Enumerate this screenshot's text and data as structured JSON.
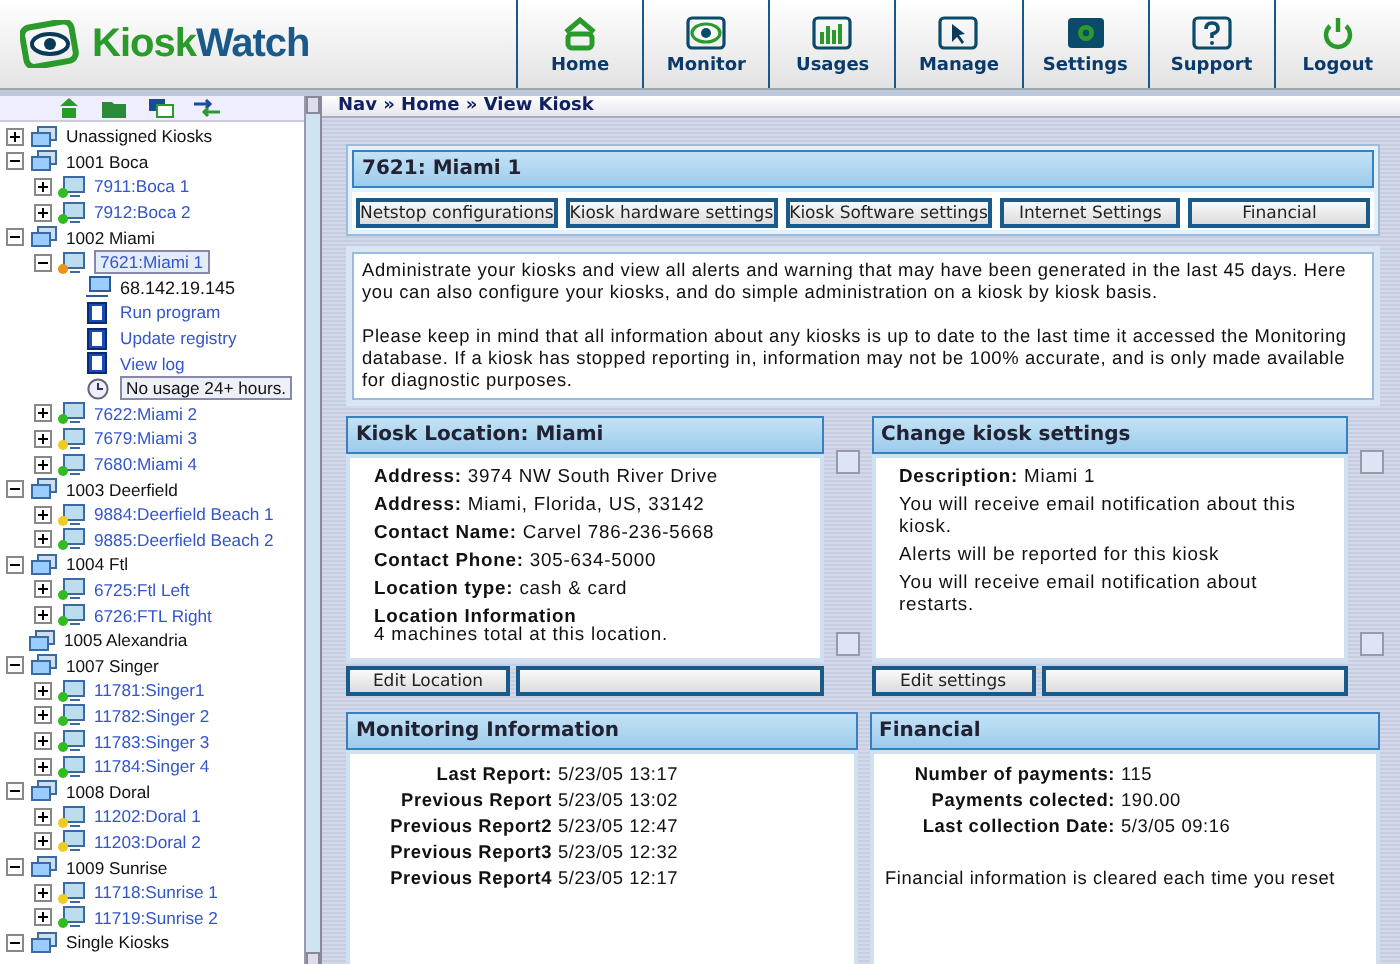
{
  "logo": {
    "first": "Kiosk",
    "second": "Watch"
  },
  "nav": [
    {
      "label": "Home"
    },
    {
      "label": "Monitor"
    },
    {
      "label": "Usages"
    },
    {
      "label": "Manage"
    },
    {
      "label": "Settings"
    },
    {
      "label": "Support"
    },
    {
      "label": "Logout"
    }
  ],
  "tree": [
    {
      "kind": "group",
      "label": "Unassigned Kiosks",
      "expanded": false
    },
    {
      "kind": "group",
      "label": "1001 Boca",
      "expanded": true,
      "children": [
        {
          "kind": "kiosk",
          "label": "7911:Boca 1",
          "expanded": false,
          "color": "#33bb22",
          "selected": false
        },
        {
          "kind": "kiosk",
          "label": "7912:Boca 2",
          "expanded": false,
          "color": "#33bb22",
          "selected": false
        }
      ]
    },
    {
      "kind": "group",
      "label": "1002 Miami",
      "expanded": true,
      "children": [
        {
          "kind": "kiosk",
          "label": "7621:Miami 1",
          "expanded": true,
          "color": "#e8941a",
          "selected": true,
          "children": [
            {
              "kind": "ip",
              "label": "68.142.19.145"
            },
            {
              "kind": "action",
              "label": "Run program"
            },
            {
              "kind": "action",
              "label": "Update registry"
            },
            {
              "kind": "action",
              "label": "View log"
            },
            {
              "kind": "alert",
              "label": "No usage 24+ hours."
            }
          ]
        },
        {
          "kind": "kiosk",
          "label": "7622:Miami 2",
          "expanded": false,
          "color": "#33bb22",
          "selected": false
        },
        {
          "kind": "kiosk",
          "label": "7679:Miami 3",
          "expanded": false,
          "color": "#eecc22",
          "selected": false
        },
        {
          "kind": "kiosk",
          "label": "7680:Miami 4",
          "expanded": false,
          "color": "#33bb22",
          "selected": false
        }
      ]
    },
    {
      "kind": "group",
      "label": "1003 Deerfield",
      "expanded": true,
      "children": [
        {
          "kind": "kiosk",
          "label": "9884:Deerfield Beach 1",
          "expanded": false,
          "color": "#eecc22",
          "selected": false
        },
        {
          "kind": "kiosk",
          "label": "9885:Deerfield Beach 2",
          "expanded": false,
          "color": "#33bb22",
          "selected": false
        }
      ]
    },
    {
      "kind": "group",
      "label": "1004 Ftl",
      "expanded": true,
      "children": [
        {
          "kind": "kiosk",
          "label": "6725:Ftl Left",
          "expanded": false,
          "color": "#33bb22",
          "selected": false
        },
        {
          "kind": "kiosk",
          "label": "6726:FTL Right",
          "expanded": false,
          "color": "#33bb22",
          "selected": false
        }
      ]
    },
    {
      "kind": "group",
      "label": "1005 Alexandria"
    },
    {
      "kind": "group",
      "label": "1007 Singer",
      "expanded": true,
      "children": [
        {
          "kind": "kiosk",
          "label": "11781:Singer1",
          "expanded": false,
          "color": "#33bb22",
          "selected": false
        },
        {
          "kind": "kiosk",
          "label": "11782:Singer 2",
          "expanded": false,
          "color": "#33bb22",
          "selected": false
        },
        {
          "kind": "kiosk",
          "label": "11783:Singer 3",
          "expanded": false,
          "color": "#33bb22",
          "selected": false
        },
        {
          "kind": "kiosk",
          "label": "11784:Singer 4",
          "expanded": false,
          "color": "#33bb22",
          "selected": false
        }
      ]
    },
    {
      "kind": "group",
      "label": "1008 Doral",
      "expanded": true,
      "children": [
        {
          "kind": "kiosk",
          "label": "11202:Doral 1",
          "expanded": false,
          "color": "#eecc22",
          "selected": false
        },
        {
          "kind": "kiosk",
          "label": "11203:Doral 2",
          "expanded": false,
          "color": "#eecc22",
          "selected": false
        }
      ]
    },
    {
      "kind": "group",
      "label": "1009 Sunrise",
      "expanded": true,
      "children": [
        {
          "kind": "kiosk",
          "label": "11718:Sunrise 1",
          "expanded": false,
          "color": "#eecc22",
          "selected": false
        },
        {
          "kind": "kiosk",
          "label": "11719:Sunrise 2",
          "expanded": false,
          "color": "#33bb22",
          "selected": false
        }
      ]
    },
    {
      "kind": "group",
      "label": "Single Kiosks",
      "expanded": true
    }
  ],
  "breadcrumb": "Nav » Home » View Kiosk",
  "kiosk_panel": {
    "title": "7621: Miami 1",
    "buttons": [
      "Netstop configurations",
      "Kiosk hardware settings",
      "Kiosk Software settings",
      "Internet Settings",
      "Financial"
    ]
  },
  "intro": [
    "Administrate your kiosks and view all alerts and warning that may have been generated in the last 45 days. Here you can also configure your kiosks, and do simple administration on a kiosk by kiosk basis.",
    "Please keep in mind that all information about any kiosks is up to date to the last time it accessed the Monitoring database. If a kiosk has stopped reporting in, information may not be 100% accurate, and is only made available for diagnostic purposes."
  ],
  "location_panel": {
    "title": "Kiosk Location: Miami",
    "rows": [
      {
        "kind": "inline",
        "label": "Address:",
        "value": "3974 NW South River Drive"
      },
      {
        "kind": "inline",
        "label": "Address:",
        "value": "Miami, Florida, US, 33142"
      },
      {
        "kind": "inline",
        "label": "Contact Name:",
        "value": "Carvel 786-236-5668"
      },
      {
        "kind": "inline",
        "label": "Contact Phone:",
        "value": "305-634-5000"
      },
      {
        "kind": "inline",
        "label": "Location type:",
        "value": "cash & card"
      },
      {
        "kind": "block",
        "label": "Location Information",
        "value": "4 machines total at this location."
      }
    ],
    "button": "Edit Location"
  },
  "settings_panel": {
    "title": "Change kiosk settings",
    "rows": [
      {
        "kind": "field",
        "label": "Description:",
        "value": "Miami 1"
      },
      {
        "kind": "note",
        "text": "You will receive email notification about this kiosk."
      },
      {
        "kind": "note",
        "text": "Alerts will be reported for this kiosk"
      },
      {
        "kind": "note",
        "text": "You will receive email notification about restarts."
      }
    ],
    "button": "Edit settings"
  },
  "monitoring_panel": {
    "title": "Monitoring Information",
    "rows": [
      {
        "label": "Last Report:",
        "value": "5/23/05 13:17"
      },
      {
        "label": "Previous Report",
        "value": "5/23/05 13:02"
      },
      {
        "label": "Previous Report2",
        "value": "5/23/05 12:47"
      },
      {
        "label": "Previous Report3",
        "value": "5/23/05 12:32"
      },
      {
        "label": "Previous Report4",
        "value": "5/23/05 12:17"
      }
    ]
  },
  "financial_panel": {
    "title": "Financial",
    "rows": [
      {
        "label": "Number of payments:",
        "value": "115"
      },
      {
        "label": "Payments colected:",
        "value": "190.00"
      },
      {
        "label": "Last collection Date:",
        "value": "5/3/05 09:16"
      }
    ],
    "note": "Financial information is cleared each time you reset"
  }
}
